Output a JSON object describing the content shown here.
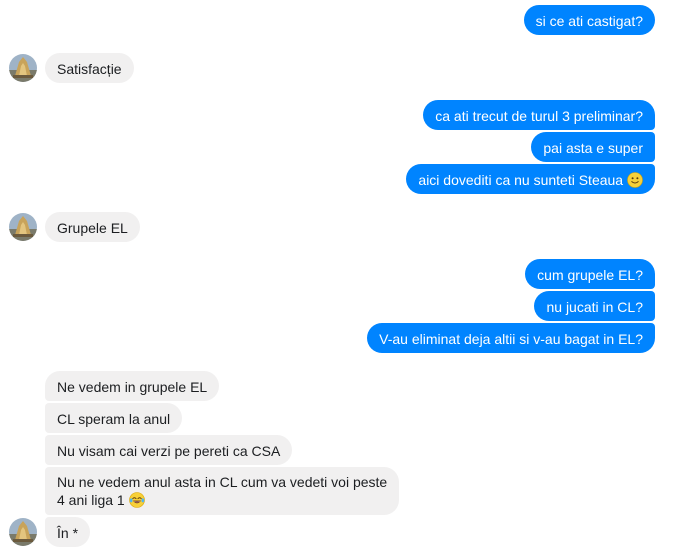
{
  "colors": {
    "outgoing_bg": "#0084ff",
    "outgoing_text": "#ffffff",
    "incoming_bg": "#f1f0f0",
    "incoming_text": "#1c1e21"
  },
  "messages": [
    {
      "side": "out",
      "text": "si ce ati castigat?"
    },
    {
      "side": "in",
      "text": "Satisfacție"
    },
    {
      "side": "out",
      "text": "ca ati trecut de turul 3 preliminar?"
    },
    {
      "side": "out",
      "text": "pai asta e super"
    },
    {
      "side": "out",
      "text": "aici dovediti ca nu sunteti Steaua",
      "emoji": "slightly-smiling-face-emoji"
    },
    {
      "side": "in",
      "text": "Grupele EL"
    },
    {
      "side": "out",
      "text": "cum grupele EL?"
    },
    {
      "side": "out",
      "text": "nu jucati in CL?"
    },
    {
      "side": "out",
      "text": "V-au eliminat deja altii si v-au bagat in EL?"
    },
    {
      "side": "in",
      "text": "Ne vedem in grupele EL"
    },
    {
      "side": "in",
      "text": "CL speram la anul"
    },
    {
      "side": "in",
      "text": "Nu visam cai verzi pe pereti ca CSA"
    },
    {
      "side": "in",
      "text_line1": "Nu ne vedem anul asta in CL cum va vedeti voi peste",
      "text_line2": "4 ani liga 1",
      "emoji": "laughing-tears-emoji"
    },
    {
      "side": "in",
      "text": "În *"
    }
  ],
  "avatar_icon": "user-avatar-photo"
}
